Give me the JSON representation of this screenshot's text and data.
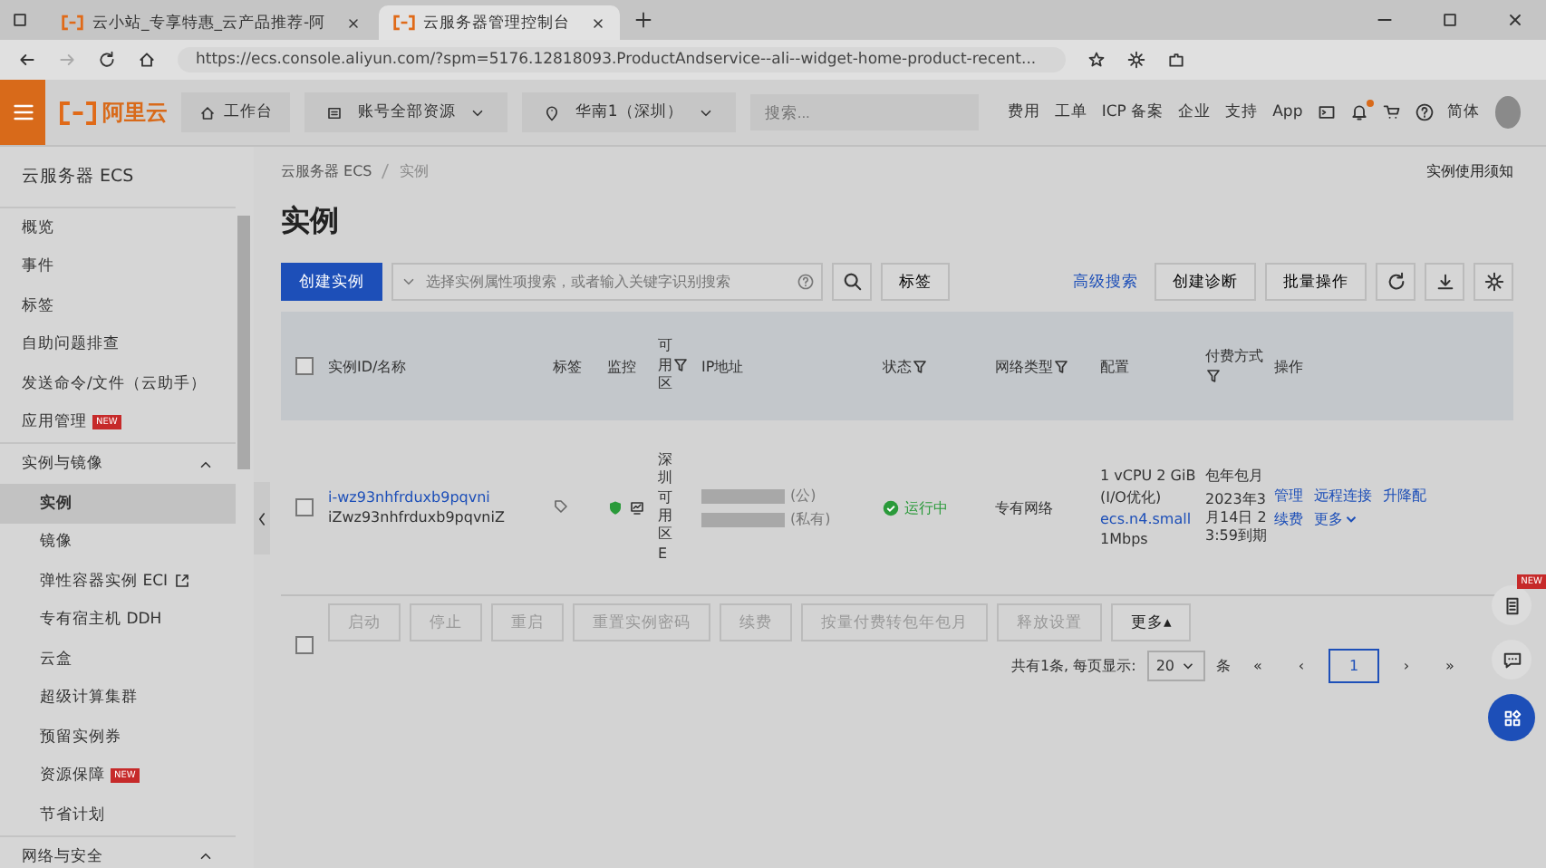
{
  "browser": {
    "tabs": [
      {
        "title": "云小站_专享特惠_云产品推荐-阿",
        "selected": false
      },
      {
        "title": "云服务器管理控制台",
        "selected": true
      }
    ],
    "url": "https://ecs.console.aliyun.com/?spm=5176.12818093.ProductAndservice--ali--widget-home-product-recent..."
  },
  "topbar": {
    "logo": "阿里云",
    "workbench": "工作台",
    "resources": "账号全部资源",
    "region": "华南1（深圳）",
    "search": {
      "placeholder": "搜索..."
    },
    "links": [
      "费用",
      "工单",
      "ICP 备案",
      "企业",
      "支持",
      "App"
    ],
    "language": "简体",
    "notification_dot": true
  },
  "sidebar": {
    "title": "云服务器 ECS",
    "items": [
      {
        "label": "概览",
        "selected": false
      },
      {
        "label": "事件",
        "selected": false
      },
      {
        "label": "标签",
        "selected": false
      },
      {
        "label": "自助问题排查",
        "selected": false
      },
      {
        "label": "发送命令/文件（云助手）",
        "selected": false
      },
      {
        "label": "应用管理",
        "selected": false,
        "badge": "NEW"
      },
      {
        "label": "实例与镜像",
        "kind": "group",
        "expanded": true,
        "children": [
          {
            "label": "实例",
            "selected": true
          },
          {
            "label": "镜像",
            "selected": false
          },
          {
            "label": "弹性容器实例 ECI",
            "selected": false,
            "external": true
          },
          {
            "label": "专有宿主机 DDH",
            "selected": false
          },
          {
            "label": "云盒",
            "selected": false
          },
          {
            "label": "超级计算集群",
            "selected": false
          },
          {
            "label": "预留实例券",
            "selected": false
          },
          {
            "label": "资源保障",
            "selected": false,
            "badge": "NEW"
          },
          {
            "label": "节省计划",
            "selected": false
          }
        ]
      },
      {
        "label": "网络与安全",
        "kind": "group",
        "expanded": true
      }
    ]
  },
  "breadcrumb": [
    "云服务器 ECS",
    "实例"
  ],
  "notice_link": "实例使用须知",
  "page_title": "实例",
  "toolbar": {
    "create": "创建实例",
    "search": {
      "placeholder": "选择实例属性项搜索，或者输入关键字识别搜索"
    },
    "tag": "标签",
    "advanced": "高级搜索",
    "diagnose": "创建诊断",
    "batch": "批量操作"
  },
  "table": {
    "select_all_checked": false,
    "columns": [
      {
        "label": "实例ID/名称",
        "filter": false
      },
      {
        "label": "标签",
        "filter": false
      },
      {
        "label": "监控",
        "filter": false
      },
      {
        "label": "可用区",
        "filter": true
      },
      {
        "label": "IP地址",
        "filter": false
      },
      {
        "label": "状态",
        "filter": true
      },
      {
        "label": "网络类型",
        "filter": true
      },
      {
        "label": "配置",
        "filter": false
      },
      {
        "label": "付费方式",
        "filter": true
      },
      {
        "label": "操作",
        "filter": false
      }
    ],
    "rows": [
      {
        "checked": false,
        "id": "i-wz93nhfrduxb9pqvni",
        "name": "iZwz93nhfrduxb9pqvniZ",
        "zone": "深圳可用区E",
        "ip_public_suffix": "(公)",
        "ip_private_suffix": "(私有)",
        "status": "运行中",
        "network": "专有网络",
        "config": [
          "1 vCPU 2 GiB",
          "(I/O优化)"
        ],
        "instance_type": "ecs.n4.small",
        "bandwidth": "1Mbps",
        "billing": "包年包月",
        "expiry": "2023年3月14日 23:59到期",
        "actions": [
          "管理",
          "远程连接",
          "升降配",
          "续费",
          "更多"
        ]
      }
    ]
  },
  "batch_select_checked": false,
  "batch_buttons": [
    "启动",
    "停止",
    "重启",
    "重置实例密码",
    "续费",
    "按量付费转包年包月",
    "释放设置"
  ],
  "more_button": "更多▴",
  "pagination": {
    "total": "共有1条, 每页显示:",
    "page_size": "20",
    "unit": "条",
    "first": "«",
    "prev": "‹",
    "pages": [
      {
        "label": "1",
        "selected": true
      }
    ],
    "next": "›",
    "last": "»"
  },
  "float_badge": "NEW"
}
